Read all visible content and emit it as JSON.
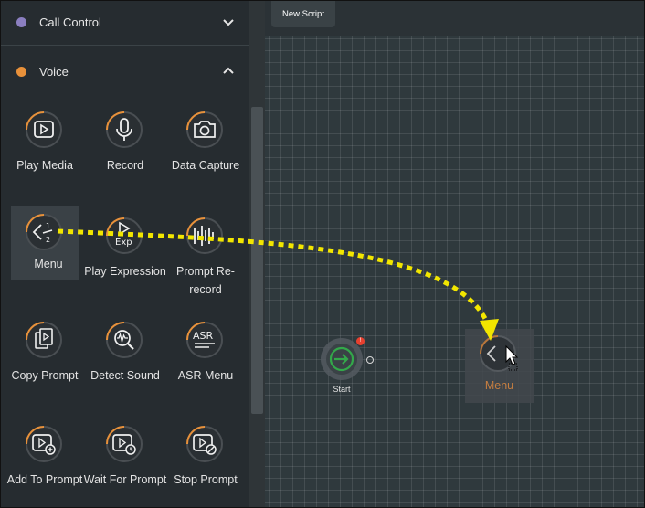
{
  "sidebar": {
    "sections": [
      {
        "label": "Call Control",
        "color": "#8b7fc0",
        "expanded": false
      },
      {
        "label": "Voice",
        "color": "#e8913a",
        "expanded": true
      }
    ],
    "tools": [
      {
        "label": "Play Media",
        "icon": "play-media-icon"
      },
      {
        "label": "Record",
        "icon": "microphone-icon"
      },
      {
        "label": "Data Capture",
        "icon": "camera-icon"
      },
      {
        "label": "Menu",
        "icon": "menu-icon",
        "selected": true
      },
      {
        "label": "Play Expression",
        "icon": "play-expression-icon"
      },
      {
        "label": "Prompt Re-record",
        "icon": "prompt-rerecord-icon"
      },
      {
        "label": "Copy Prompt",
        "icon": "copy-prompt-icon"
      },
      {
        "label": "Detect Sound",
        "icon": "detect-sound-icon"
      },
      {
        "label": "ASR Menu",
        "icon": "asr-menu-icon"
      },
      {
        "label": "Add To Prompt",
        "icon": "add-to-prompt-icon"
      },
      {
        "label": "Wait For Prompt",
        "icon": "wait-for-prompt-icon"
      },
      {
        "label": "Stop Prompt",
        "icon": "stop-prompt-icon"
      }
    ]
  },
  "canvas": {
    "tab_label": "New Script",
    "start_node": {
      "label": "Start",
      "badge": "!"
    },
    "dragged_node": {
      "label": "Menu",
      "icon": "menu-icon"
    }
  },
  "colors": {
    "accent": "#e8913a",
    "drag_arrow": "#f2e600",
    "start_green": "#33a84a",
    "error_badge": "#e8402f"
  }
}
